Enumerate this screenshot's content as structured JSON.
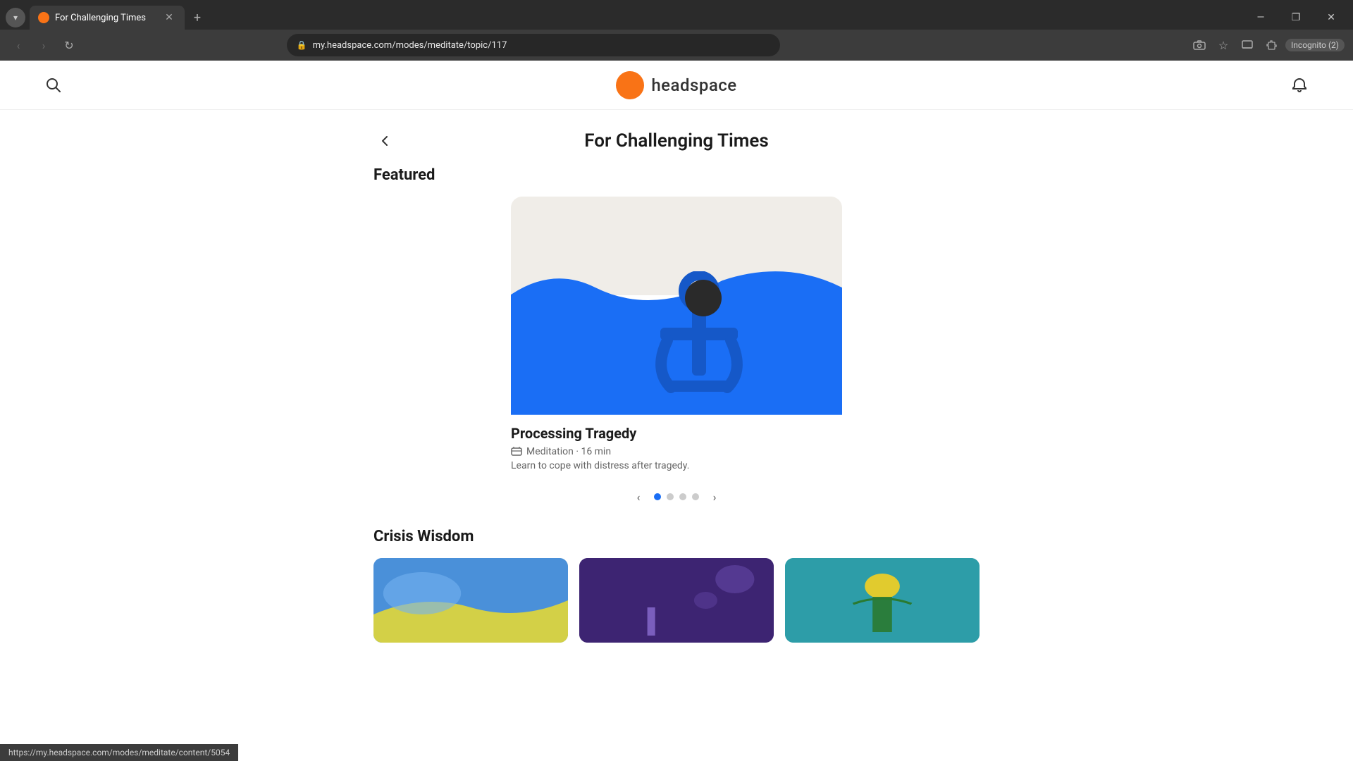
{
  "browser": {
    "tab_title": "For Challenging Times",
    "tab_favicon_color": "#f97316",
    "url": "my.headspace.com/modes/meditate/topic/117",
    "incognito_label": "Incognito (2)",
    "new_tab_label": "+",
    "window_controls": {
      "minimize": "—",
      "maximize": "❐",
      "close": "✕"
    }
  },
  "nav": {
    "logo_text": "headspace"
  },
  "page": {
    "title": "For Challenging Times",
    "back_label": "‹",
    "featured_section_label": "Featured",
    "featured_card": {
      "title": "Processing Tragedy",
      "meta": "Meditation · 16 min",
      "description": "Learn to cope with distress after tragedy."
    },
    "carousel": {
      "dots": [
        {
          "active": true
        },
        {
          "active": false
        },
        {
          "active": false
        },
        {
          "active": false
        }
      ],
      "prev_arrow": "‹",
      "next_arrow": "›"
    },
    "crisis_section_label": "Crisis Wisdom",
    "crisis_cards": [
      {
        "color": "blue"
      },
      {
        "color": "purple"
      },
      {
        "color": "teal"
      }
    ]
  },
  "status_bar": {
    "url": "https://my.headspace.com/modes/meditate/content/5054"
  }
}
